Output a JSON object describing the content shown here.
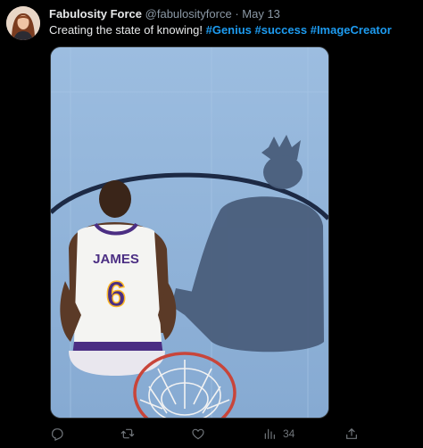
{
  "tweet": {
    "author_name": "Fabulosity Force",
    "handle": "@fabulosityforce",
    "separator": "·",
    "date": "May 13",
    "text_prefix": "Creating the state of knowing! ",
    "hashtags": [
      "#Genius",
      "#success",
      "#ImageCreator"
    ]
  },
  "media": {
    "jersey_name": "JAMES",
    "jersey_number": "6"
  },
  "actions": {
    "reply_icon": "reply-icon",
    "retweet_icon": "retweet-icon",
    "like_icon": "like-icon",
    "views_icon": "views-icon",
    "views_count": "34",
    "share_icon": "share-icon"
  },
  "colors": {
    "background": "#000000",
    "text": "#e7e9ea",
    "muted": "#8b98a5",
    "link": "#1d9bf0",
    "court": "#8fb3da"
  }
}
